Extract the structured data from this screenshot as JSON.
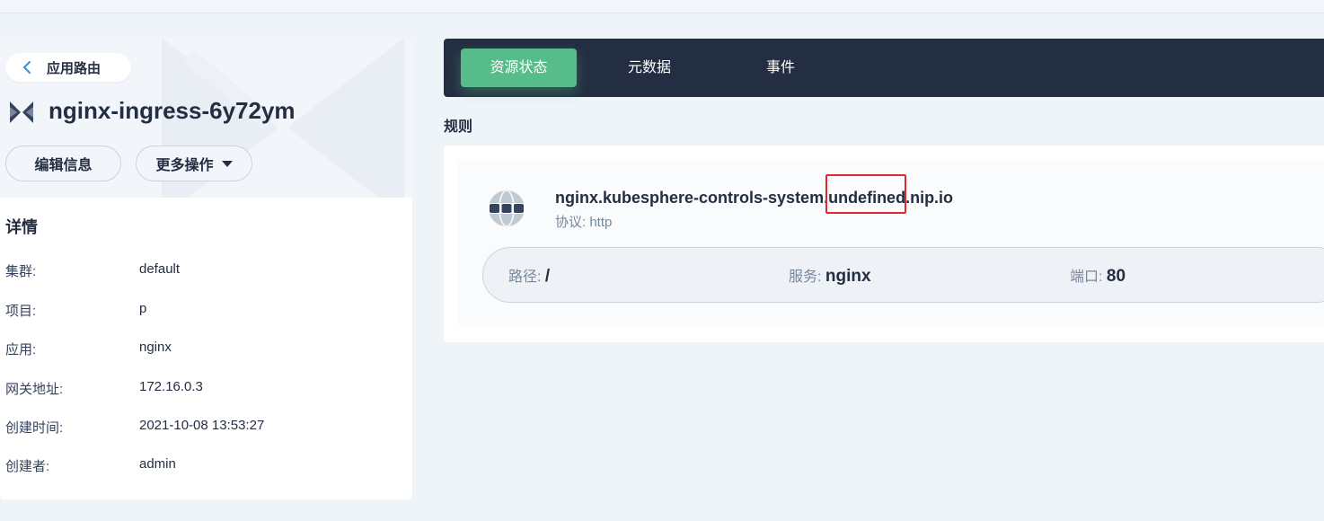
{
  "nav": {
    "back_label": "应用路由"
  },
  "resource": {
    "name": "nginx-ingress-6y72ym",
    "icon": "ingress-icon"
  },
  "actions": {
    "edit_label": "编辑信息",
    "more_label": "更多操作"
  },
  "details": {
    "title": "详情",
    "rows": [
      {
        "key": "集群:",
        "value": "default"
      },
      {
        "key": "项目:",
        "value": "p"
      },
      {
        "key": "应用:",
        "value": "nginx"
      },
      {
        "key": "网关地址:",
        "value": "172.16.0.3"
      },
      {
        "key": "创建时间:",
        "value": "2021-10-08 13:53:27"
      },
      {
        "key": "创建者:",
        "value": "admin"
      }
    ]
  },
  "tabs": [
    {
      "label": "资源状态",
      "active": true
    },
    {
      "label": "元数据",
      "active": false
    },
    {
      "label": "事件",
      "active": false
    }
  ],
  "rules": {
    "label": "规则",
    "items": [
      {
        "host": "nginx.kubesphere-controls-system.undefined.nip.io",
        "protocol": "协议: http",
        "path_key": "路径:",
        "path_value": "/",
        "service_key": "服务:",
        "service_value": "nginx",
        "port_key": "端口:",
        "port_value": "80"
      }
    ]
  },
  "colors": {
    "accent": "#55bc8a",
    "dark": "#242e42",
    "highlight_box": "#e0282e"
  }
}
